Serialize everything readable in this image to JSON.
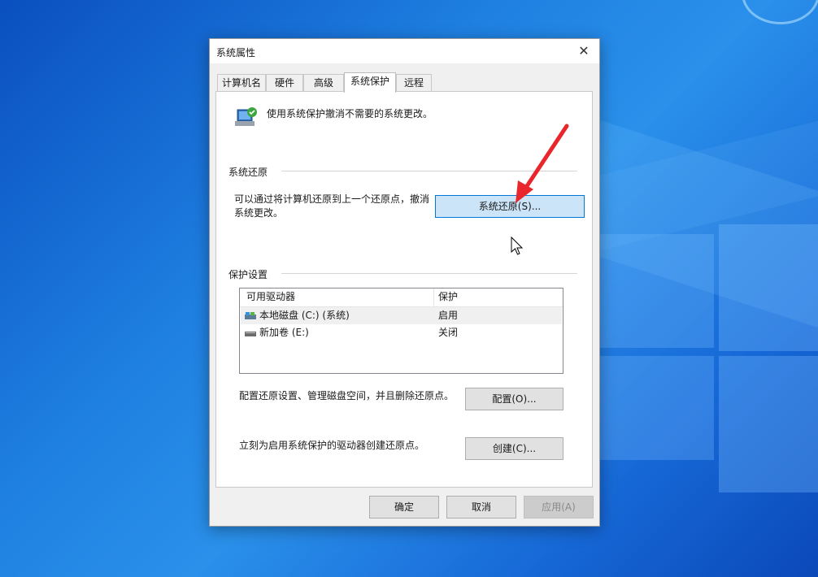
{
  "dialog": {
    "title": "系统属性",
    "close_icon": "close-icon"
  },
  "tabs": [
    {
      "label": "计算机名"
    },
    {
      "label": "硬件"
    },
    {
      "label": "高级"
    },
    {
      "label": "系统保护",
      "active": true
    },
    {
      "label": "远程"
    }
  ],
  "header": {
    "icon": "system-protection-icon",
    "text": "使用系统保护撤消不需要的系统更改。"
  },
  "restore": {
    "group_label": "系统还原",
    "desc_line1": "可以通过将计算机还原到上一个还原点，撤消",
    "desc_line2": "系统更改。",
    "button": "系统还原(S)..."
  },
  "protection": {
    "group_label": "保护设置",
    "columns": [
      "可用驱动器",
      "保护"
    ],
    "drives": [
      {
        "name": "本地磁盘 (C:) (系统)",
        "status": "启用",
        "icon": "system-drive-icon"
      },
      {
        "name": "新加卷 (E:)",
        "status": "关闭",
        "icon": "drive-icon"
      }
    ],
    "config_desc": "配置还原设置、管理磁盘空间，并且删除还原点。",
    "config_button": "配置(O)...",
    "create_desc": "立刻为启用系统保护的驱动器创建还原点。",
    "create_button": "创建(C)..."
  },
  "footer": {
    "ok": "确定",
    "cancel": "取消",
    "apply": "应用(A)"
  },
  "colors": {
    "accent": "#0078d7",
    "primary_button_bg": "#cce4f7",
    "annotation_arrow": "#e8262b"
  }
}
